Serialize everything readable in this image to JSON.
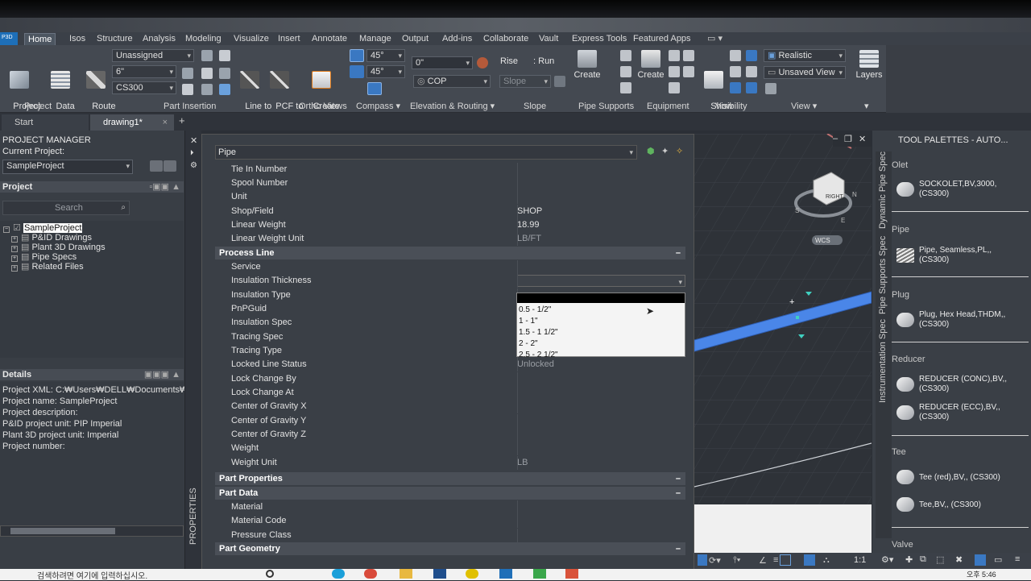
{
  "app": {
    "logo": "P3D"
  },
  "menus": [
    "Home",
    "Isos",
    "Structure",
    "Analysis",
    "Modeling",
    "Visualize",
    "Insert",
    "Annotate",
    "Manage",
    "Output",
    "Add-ins",
    "Collaborate",
    "Vault",
    "Express Tools",
    "Featured Apps"
  ],
  "ribbon": {
    "project_manager": "Project\nManager",
    "data_manager": "Data\nManager",
    "route_pipe": "Route\nPipe",
    "unassigned": "Unassigned",
    "size": "6\"",
    "spec": "CS300",
    "line_to_pipe": "Line to\nPipe",
    "pcf_to_pipe": "PCF to\nPipe",
    "create_ortho": "Create\nOrtho View",
    "angle1": "45°",
    "angle2": "45°",
    "elevation": "0\"",
    "cop": "COP",
    "rise": "Rise",
    "run": "Run",
    "slope": "Slope",
    "create_supports": "Create",
    "create_equipment": "Create",
    "show_all": "Show\nAll",
    "visual_style": "Realistic",
    "view": "Unsaved View",
    "layers": "Layers",
    "panels": {
      "project": "Project",
      "part_insertion": "Part Insertion",
      "ortho_views": "Ortho Views",
      "compass": "Compass ▾",
      "elevation_routing": "Elevation & Routing ▾",
      "slope": "Slope",
      "pipe_supports": "Pipe Supports",
      "equipment": "Equipment",
      "visibility": "Visibility",
      "view": "View ▾"
    }
  },
  "tabs": {
    "start": "Start",
    "drawing": "drawing1*",
    "close": "×",
    "add": "+"
  },
  "project_manager": {
    "title": "PROJECT MANAGER",
    "current_project_label": "Current Project:",
    "current_project": "SampleProject",
    "project_section": "Project",
    "search_placeholder": "Search",
    "tree": [
      {
        "label": "SampleProject",
        "level": 0
      },
      {
        "label": "P&ID Drawings",
        "level": 1
      },
      {
        "label": "Plant 3D Drawings",
        "level": 1
      },
      {
        "label": "Pipe Specs",
        "level": 1
      },
      {
        "label": "Related Files",
        "level": 1
      }
    ],
    "details_title": "Details",
    "details": [
      "Project  XML:  C:₩Users₩DELL₩Documents₩Sam",
      "Project  name: SampleProject",
      "Project  description:",
      "P&ID project unit: PIP Imperial",
      "Plant 3D project unit: Imperial",
      "Project number:"
    ]
  },
  "properties": {
    "strip_label": "PROPERTIES",
    "selector": "Pipe",
    "rows_top": [
      {
        "k": "Tie In Number",
        "v": ""
      },
      {
        "k": "Spool Number",
        "v": ""
      },
      {
        "k": "Unit",
        "v": ""
      },
      {
        "k": "Shop/Field",
        "v": "SHOP"
      },
      {
        "k": "Linear Weight",
        "v": "18.99"
      },
      {
        "k": "Linear Weight Unit",
        "v": "LB/FT"
      }
    ],
    "process_line": "Process Line",
    "rows_process": [
      {
        "k": "Service",
        "v": ""
      },
      {
        "k": "Insulation Thickness",
        "v": ""
      },
      {
        "k": "Insulation Type",
        "v": ""
      },
      {
        "k": "PnPGuid",
        "v": ""
      },
      {
        "k": "Insulation Spec",
        "v": ""
      },
      {
        "k": "Tracing Spec",
        "v": ""
      },
      {
        "k": "Tracing Type",
        "v": ""
      },
      {
        "k": "Locked Line Status",
        "v": "Unlocked"
      },
      {
        "k": "Lock Change By",
        "v": ""
      },
      {
        "k": "Lock Change At",
        "v": ""
      },
      {
        "k": "Center of Gravity X",
        "v": ""
      },
      {
        "k": "Center of Gravity Y",
        "v": ""
      },
      {
        "k": "Center of Gravity Z",
        "v": ""
      },
      {
        "k": "Weight",
        "v": ""
      },
      {
        "k": "Weight Unit",
        "v": "LB"
      }
    ],
    "part_properties": "Part Properties",
    "part_data": "Part Data",
    "rows_part": [
      {
        "k": "Material",
        "v": ""
      },
      {
        "k": "Material Code",
        "v": ""
      },
      {
        "k": "Pressure Class",
        "v": ""
      }
    ],
    "part_geometry": "Part Geometry",
    "collapse": "–",
    "dropdown_options": [
      "0.5 - 1/2\"",
      "1 - 1\"",
      "1.5 - 1 1/2\"",
      "2 - 2\"",
      "2.5 - 2 1/2\""
    ]
  },
  "viewport": {
    "wcs": "WCS",
    "cube_face": "RIGHT",
    "compass": [
      "S",
      "E",
      "N"
    ]
  },
  "palettes": {
    "title": "TOOL PALETTES - AUTO...",
    "side_tabs": [
      "Dynamic Pipe Spec",
      "Pipe Supports Spec",
      "Instrumentation Spec"
    ],
    "groups": [
      {
        "cat": "Olet",
        "items": [
          "SOCKOLET,BV,3000,\n(CS300)"
        ]
      },
      {
        "cat": "Pipe",
        "items": [
          "Pipe, Seamless,PL,,\n(CS300)"
        ]
      },
      {
        "cat": "Plug",
        "items": [
          "Plug, Hex Head,THDM,,\n(CS300)"
        ]
      },
      {
        "cat": "Reducer",
        "items": [
          "REDUCER (CONC),BV,,\n(CS300)",
          "REDUCER (ECC),BV,,\n(CS300)"
        ]
      },
      {
        "cat": "Tee",
        "items": [
          "Tee (red),BV,, (CS300)",
          "Tee,BV,, (CS300)"
        ]
      },
      {
        "cat": "Valve",
        "items": []
      }
    ]
  },
  "statusbar": {
    "scale": "1:1"
  },
  "taskbar": {
    "search": "검색하려면 여기에 입력하십시오.",
    "time": "오후 5:46"
  }
}
